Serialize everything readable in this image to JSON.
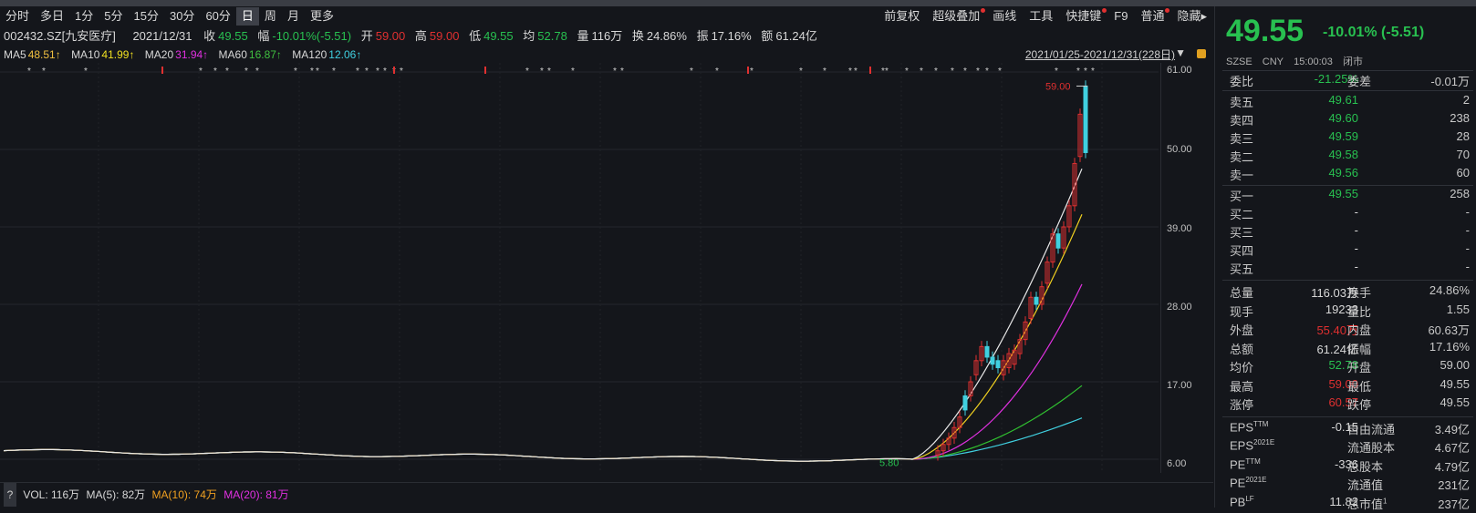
{
  "toolbar": {
    "periods": [
      "分时",
      "多日",
      "1分",
      "5分",
      "15分",
      "30分",
      "60分",
      "日",
      "周",
      "月",
      "更多"
    ],
    "active": "日",
    "right_items": [
      "前复权",
      "超级叠加",
      "画线",
      "工具",
      "快捷键",
      "F9",
      "普通",
      "隐藏"
    ]
  },
  "info": {
    "code": "002432.SZ[九安医疗]",
    "date": "2021/12/31",
    "close_label": "收",
    "close": "49.55",
    "chg_label": "幅",
    "chg": "-10.01%(-5.51)",
    "open_label": "开",
    "open": "59.00",
    "high_label": "高",
    "high": "59.00",
    "low_label": "低",
    "low": "49.55",
    "avg_label": "均",
    "avg": "52.78",
    "vol_label": "量",
    "vol": "116万",
    "turnover_label": "换",
    "turnover": "24.86%",
    "amp_label": "振",
    "amp": "17.16%",
    "amt_label": "额",
    "amt": "61.24亿"
  },
  "ma": {
    "ma5_label": "MA5",
    "ma5": "48.51↑",
    "ma10_label": "MA10",
    "ma10": "41.99↑",
    "ma20_label": "MA20",
    "ma20": "31.94↑",
    "ma60_label": "MA60",
    "ma60": "16.87↑",
    "ma120_label": "MA120",
    "ma120": "12.06↑",
    "range": "2021/01/25-2021/12/31(228日)"
  },
  "chart_data": {
    "type": "line",
    "ylabels": [
      "61.00",
      "50.00",
      "39.00",
      "28.00",
      "17.00",
      "6.00"
    ],
    "ylim": [
      6,
      61
    ],
    "high_label": "59.00",
    "low_label": "5.80",
    "colors": {
      "ma5": "#e8e8e8",
      "ma10": "#f0d020",
      "ma20": "#e030e0",
      "ma60": "#30c030",
      "ma120": "#40d0e0",
      "up": "#e03030",
      "down": "#40d0e0"
    }
  },
  "vol": {
    "help": "?",
    "vol_label": "VOL: 116万",
    "ma5_label": "MA(5): 82万",
    "ma10_label": "MA(10): 74万",
    "ma20_label": "MA(20): 81万"
  },
  "quote": {
    "price": "49.55",
    "change": "-10.01% (-5.51)",
    "exchange": "SZSE",
    "currency": "CNY",
    "time": "15:00:03",
    "status": "闭市",
    "weibi_label": "委比",
    "weibi": "-21.25%",
    "weicha_label": "委差",
    "weicha": "-0.01万",
    "asks": [
      {
        "label": "卖五",
        "price": "49.61",
        "vol": "2"
      },
      {
        "label": "卖四",
        "price": "49.60",
        "vol": "238"
      },
      {
        "label": "卖三",
        "price": "49.59",
        "vol": "28"
      },
      {
        "label": "卖二",
        "price": "49.58",
        "vol": "70"
      },
      {
        "label": "卖一",
        "price": "49.56",
        "vol": "60"
      }
    ],
    "bids": [
      {
        "label": "买一",
        "price": "49.55",
        "vol": "258"
      },
      {
        "label": "买二",
        "price": "-",
        "vol": "-"
      },
      {
        "label": "买三",
        "price": "-",
        "vol": "-"
      },
      {
        "label": "买四",
        "price": "-",
        "vol": "-"
      },
      {
        "label": "买五",
        "price": "-",
        "vol": "-"
      }
    ],
    "stats": [
      {
        "l": "总量",
        "v": "116.03万",
        "l2": "换手",
        "v2": "24.86%",
        "c": "w",
        "c2": "w"
      },
      {
        "l": "现手",
        "v": "19233",
        "l2": "量比",
        "v2": "1.55",
        "c": "w",
        "c2": "w"
      },
      {
        "l": "外盘",
        "v": "55.40万",
        "l2": "内盘",
        "v2": "60.63万",
        "c": "rd",
        "c2": "g"
      },
      {
        "l": "总额",
        "v": "61.24亿",
        "l2": "振幅",
        "v2": "17.16%",
        "c": "w",
        "c2": "w"
      },
      {
        "l": "均价",
        "v": "52.78",
        "l2": "开盘",
        "v2": "59.00",
        "c": "g",
        "c2": "rd"
      },
      {
        "l": "最高",
        "v": "59.00",
        "l2": "最低",
        "v2": "49.55",
        "c": "rd",
        "c2": "g"
      },
      {
        "l": "涨停",
        "v": "60.57",
        "l2": "跌停",
        "v2": "49.55",
        "c": "rd",
        "c2": "g"
      }
    ],
    "fin": [
      {
        "l": "EPS",
        "sup": "TTM",
        "v": "-0.15",
        "l2": "自由流通",
        "v2": "3.49亿"
      },
      {
        "l": "EPS",
        "sup": "2021E",
        "v": "",
        "l2": "流通股本",
        "v2": "4.67亿"
      },
      {
        "l": "PE",
        "sup": "TTM",
        "v": "-336",
        "l2": "总股本",
        "v2": "4.79亿"
      },
      {
        "l": "PE",
        "sup": "2021E",
        "v": "-",
        "l2": "流通值",
        "v2": "231亿"
      },
      {
        "l": "PB",
        "sup": "LF",
        "v": "11.82",
        "l2": "总市值",
        "sup2": "1",
        "v2": "237亿"
      }
    ]
  }
}
